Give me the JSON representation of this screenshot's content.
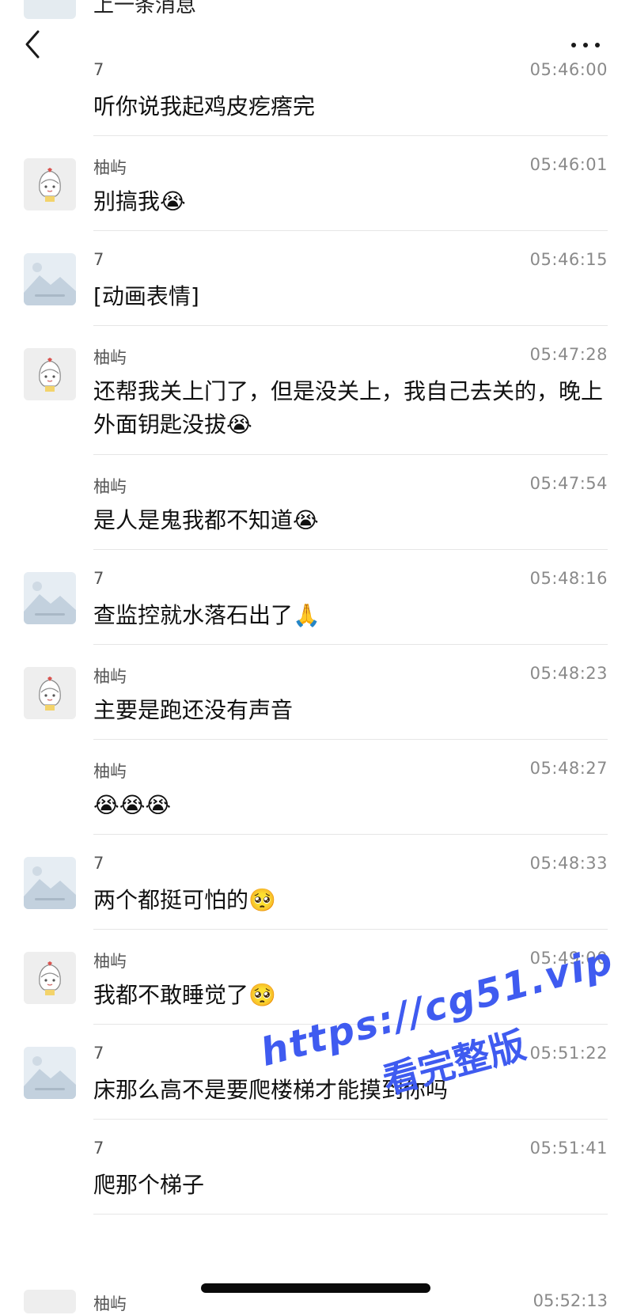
{
  "header": {
    "back_icon": "chevron-left-icon",
    "more_icon": "ellipsis-icon",
    "partial_top_text": "上一条消息"
  },
  "messages": [
    {
      "sender": "7",
      "time": "05:46:00",
      "text": "听你说我起鸡皮疙瘩完",
      "avatar": "none"
    },
    {
      "sender": "柚屿",
      "time": "05:46:01",
      "text": "别搞我😭",
      "avatar": "girl"
    },
    {
      "sender": "7",
      "time": "05:46:15",
      "text": "[动画表情]",
      "avatar": "landscape"
    },
    {
      "sender": "柚屿",
      "time": "05:47:28",
      "text": "还帮我关上门了，但是没关上，我自己去关的，晚上外面钥匙没拔😭",
      "avatar": "girl"
    },
    {
      "sender": "柚屿",
      "time": "05:47:54",
      "text": "是人是鬼我都不知道😭",
      "avatar": "none"
    },
    {
      "sender": "7",
      "time": "05:48:16",
      "text": "查监控就水落石出了🙏",
      "avatar": "landscape"
    },
    {
      "sender": "柚屿",
      "time": "05:48:23",
      "text": "主要是跑还没有声音",
      "avatar": "girl"
    },
    {
      "sender": "柚屿",
      "time": "05:48:27",
      "text": "😭😭😭",
      "avatar": "none"
    },
    {
      "sender": "7",
      "time": "05:48:33",
      "text": "两个都挺可怕的🥺",
      "avatar": "landscape"
    },
    {
      "sender": "柚屿",
      "time": "05:49:00",
      "text": "我都不敢睡觉了🥺",
      "avatar": "girl"
    },
    {
      "sender": "7",
      "time": "05:51:22",
      "text": "床那么高不是要爬楼梯才能摸到你吗",
      "avatar": "landscape"
    },
    {
      "sender": "7",
      "time": "05:51:41",
      "text": "爬那个梯子",
      "avatar": "none"
    }
  ],
  "partial_bottom": {
    "sender": "柚屿",
    "time": "05:52:13"
  },
  "watermark": {
    "url": "https://cg51.vip",
    "caption": "看完整版"
  },
  "colors": {
    "watermark": "#3f5bf0",
    "divider": "#e6e6e6",
    "time": "#8a8a8a"
  }
}
